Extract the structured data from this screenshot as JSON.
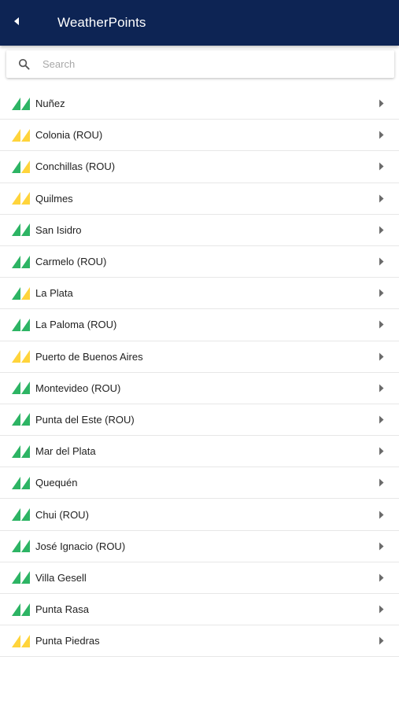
{
  "colors": {
    "header_bg": "#0d2454",
    "good": "#2db464",
    "fair": "#ffd43b"
  },
  "header": {
    "title": "WeatherPoints",
    "back_icon": "back-arrow-icon"
  },
  "search": {
    "placeholder": "Search",
    "value": "",
    "icon": "search-icon"
  },
  "locations": [
    {
      "name": "Nuñez",
      "status": "good"
    },
    {
      "name": "Colonia (ROU)",
      "status": "fair"
    },
    {
      "name": "Conchillas (ROU)",
      "status": "mixed"
    },
    {
      "name": "Quilmes",
      "status": "fair"
    },
    {
      "name": "San Isidro",
      "status": "good"
    },
    {
      "name": "Carmelo (ROU)",
      "status": "good"
    },
    {
      "name": "La Plata",
      "status": "mixed"
    },
    {
      "name": "La Paloma (ROU)",
      "status": "good"
    },
    {
      "name": "Puerto de Buenos Aires",
      "status": "fair"
    },
    {
      "name": "Montevideo (ROU)",
      "status": "good"
    },
    {
      "name": "Punta del Este (ROU)",
      "status": "good"
    },
    {
      "name": "Mar del Plata",
      "status": "good"
    },
    {
      "name": "Quequén",
      "status": "good"
    },
    {
      "name": "Chui (ROU)",
      "status": "good"
    },
    {
      "name": "José Ignacio (ROU)",
      "status": "good"
    },
    {
      "name": "Villa Gesell",
      "status": "good"
    },
    {
      "name": "Punta Rasa",
      "status": "good"
    },
    {
      "name": "Punta Piedras",
      "status": "fair"
    }
  ]
}
